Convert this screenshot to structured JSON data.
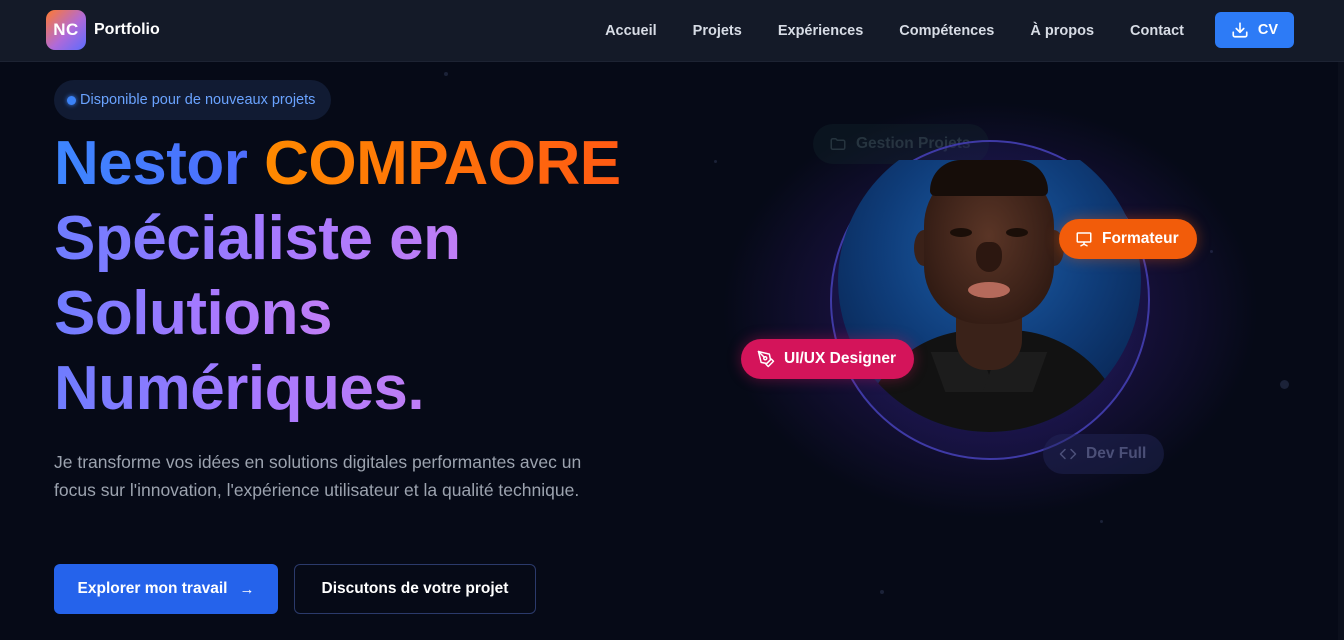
{
  "brand": {
    "logo_text": "NC",
    "name": "Portfolio"
  },
  "nav": {
    "links": [
      "Accueil",
      "Projets",
      "Expériences",
      "Compétences",
      "À propos",
      "Contact"
    ],
    "cv_label": "CV"
  },
  "hero": {
    "badge": "Disponible pour de nouveaux projets",
    "first_name": "Nestor",
    "last_name": "COMPAORE",
    "tagline_lines": [
      "Spécialiste en",
      "Solutions",
      "Numériques."
    ],
    "description": "Je transforme vos idées en solutions digitales performantes avec un focus sur l'innovation, l'expérience utilisateur et la qualité technique.",
    "primary_button": "Explorer mon travail",
    "primary_button_arrow": "→",
    "secondary_button": "Discutons de votre projet"
  },
  "floating_tags": {
    "formateur": "Formateur",
    "uiux": "UI/UX Designer",
    "devfull": "Dev Full",
    "gestion": "Gestion Projets"
  },
  "colors": {
    "accent_blue": "#2d7bf6",
    "name_orange": "#ff7a0a",
    "tag_orange": "#f25c0a",
    "tag_pink": "#d4145a",
    "background": "#060a17"
  },
  "icons": {
    "cv": "download-icon",
    "formateur": "presentation-icon",
    "uiux": "pen-tool-icon",
    "devfull": "code-icon",
    "gestion": "folder-icon",
    "primary_button": "arrow-right-icon"
  }
}
